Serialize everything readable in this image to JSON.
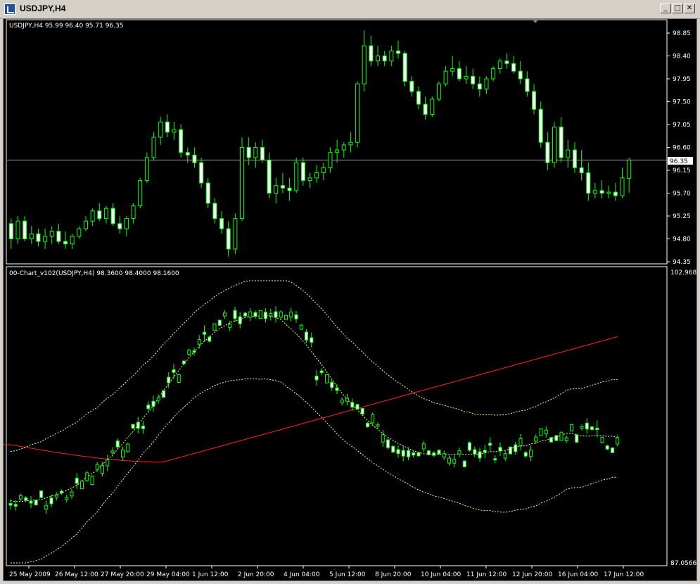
{
  "window": {
    "title": "USDJPY,H4",
    "controls": [
      "_",
      "□",
      "✕"
    ]
  },
  "main_panel": {
    "header": "USDJPY,H4  95.99 96.40 95.71 96.35",
    "current_price": "96.35",
    "yaxis_labels": [
      "98.85",
      "98.40",
      "97.95",
      "97.50",
      "97.05",
      "96.60",
      "96.15",
      "95.70",
      "95.25",
      "94.80",
      "94.35"
    ]
  },
  "indicator_panel": {
    "header": "00-Chart_v102(USDJPY,H4) 98.3600 98.4000 98.1600",
    "ymax_label": "102.9684",
    "ymin_label": "87.0566"
  },
  "xaxis_labels": [
    "25 May 2009",
    "26 May 12:00",
    "27 May 20:00",
    "29 May 04:00",
    "1 Jun 12:00",
    "2 Jun 20:00",
    "4 Jun 04:00",
    "5 Jun 12:00",
    "8 Jun 20:00",
    "10 Jun 04:00",
    "11 Jun 12:00",
    "12 Jun 20:00",
    "16 Jun 04:00",
    "17 Jun 12:00"
  ],
  "colors": {
    "background": "#000000",
    "candle": "#00ff00",
    "bull_body": "#000000",
    "bear_body": "#ffffff",
    "band": "#ffff66",
    "ma": "#ff2020",
    "price_line": "#a0a0a0",
    "axis": "#ffffff"
  },
  "chart_data": {
    "type": "candlestick",
    "symbol": "USDJPY",
    "timeframe": "H4",
    "ylim": [
      94.35,
      98.85
    ],
    "last_close": 96.35,
    "candles": [
      [
        95.1,
        95.2,
        94.6,
        94.8
      ],
      [
        94.8,
        95.25,
        94.7,
        95.15
      ],
      [
        95.15,
        95.25,
        94.75,
        94.8
      ],
      [
        94.8,
        95.05,
        94.7,
        94.9
      ],
      [
        94.9,
        95.0,
        94.65,
        94.75
      ],
      [
        94.75,
        95.0,
        94.6,
        94.85
      ],
      [
        94.85,
        95.05,
        94.7,
        94.95
      ],
      [
        94.95,
        95.1,
        94.7,
        94.75
      ],
      [
        94.75,
        94.95,
        94.6,
        94.7
      ],
      [
        94.7,
        94.9,
        94.6,
        94.85
      ],
      [
        94.85,
        95.05,
        94.8,
        95.0
      ],
      [
        95.0,
        95.25,
        94.95,
        95.15
      ],
      [
        95.15,
        95.4,
        95.05,
        95.35
      ],
      [
        95.35,
        95.5,
        95.15,
        95.2
      ],
      [
        95.2,
        95.45,
        95.1,
        95.4
      ],
      [
        95.4,
        95.5,
        95.05,
        95.1
      ],
      [
        95.1,
        95.25,
        94.9,
        95.0
      ],
      [
        95.0,
        95.25,
        94.85,
        95.2
      ],
      [
        95.2,
        95.5,
        95.1,
        95.45
      ],
      [
        95.45,
        96.0,
        95.4,
        95.95
      ],
      [
        95.95,
        96.5,
        95.9,
        96.4
      ],
      [
        96.4,
        96.9,
        96.35,
        96.8
      ],
      [
        96.8,
        97.2,
        96.65,
        97.1
      ],
      [
        97.1,
        97.25,
        96.8,
        96.9
      ],
      [
        96.9,
        97.1,
        96.75,
        96.95
      ],
      [
        96.95,
        97.05,
        96.4,
        96.5
      ],
      [
        96.5,
        96.6,
        96.3,
        96.45
      ],
      [
        96.45,
        96.6,
        96.2,
        96.3
      ],
      [
        96.3,
        96.4,
        95.8,
        95.9
      ],
      [
        95.9,
        96.0,
        95.4,
        95.5
      ],
      [
        95.5,
        95.6,
        95.1,
        95.2
      ],
      [
        95.2,
        95.35,
        94.9,
        95.0
      ],
      [
        95.0,
        95.15,
        94.45,
        94.6
      ],
      [
        94.6,
        95.3,
        94.5,
        95.2
      ],
      [
        95.2,
        96.8,
        95.15,
        96.6
      ],
      [
        96.6,
        96.8,
        96.25,
        96.4
      ],
      [
        96.4,
        96.7,
        96.2,
        96.6
      ],
      [
        96.6,
        96.75,
        96.3,
        96.35
      ],
      [
        96.35,
        96.5,
        95.6,
        95.7
      ],
      [
        95.7,
        96.0,
        95.5,
        95.85
      ],
      [
        95.85,
        96.1,
        95.7,
        95.8
      ],
      [
        95.8,
        96.0,
        95.55,
        95.75
      ],
      [
        95.75,
        96.4,
        95.7,
        96.3
      ],
      [
        96.3,
        96.4,
        95.85,
        95.95
      ],
      [
        95.95,
        96.1,
        95.8,
        96.0
      ],
      [
        96.0,
        96.25,
        95.9,
        96.1
      ],
      [
        96.1,
        96.3,
        95.95,
        96.2
      ],
      [
        96.2,
        96.6,
        96.1,
        96.5
      ],
      [
        96.5,
        96.75,
        96.3,
        96.55
      ],
      [
        96.55,
        96.7,
        96.4,
        96.65
      ],
      [
        96.65,
        96.9,
        96.5,
        96.7
      ],
      [
        96.7,
        97.9,
        96.6,
        97.85
      ],
      [
        97.85,
        98.9,
        97.7,
        98.6
      ],
      [
        98.6,
        98.8,
        98.2,
        98.3
      ],
      [
        98.3,
        98.6,
        98.2,
        98.4
      ],
      [
        98.4,
        98.5,
        98.2,
        98.3
      ],
      [
        98.3,
        98.6,
        98.2,
        98.5
      ],
      [
        98.5,
        98.7,
        98.35,
        98.45
      ],
      [
        98.45,
        98.5,
        97.8,
        97.9
      ],
      [
        97.9,
        98.0,
        97.6,
        97.7
      ],
      [
        97.7,
        97.8,
        97.35,
        97.45
      ],
      [
        97.45,
        97.6,
        97.15,
        97.25
      ],
      [
        97.25,
        97.6,
        97.2,
        97.55
      ],
      [
        97.55,
        97.9,
        97.5,
        97.85
      ],
      [
        97.85,
        98.2,
        97.8,
        98.1
      ],
      [
        98.1,
        98.4,
        98.0,
        98.15
      ],
      [
        98.15,
        98.3,
        97.9,
        97.95
      ],
      [
        97.95,
        98.2,
        97.85,
        98.0
      ],
      [
        98.0,
        98.15,
        97.75,
        97.85
      ],
      [
        97.85,
        98.0,
        97.6,
        97.75
      ],
      [
        97.75,
        98.0,
        97.65,
        97.95
      ],
      [
        97.95,
        98.2,
        97.9,
        98.15
      ],
      [
        98.15,
        98.35,
        98.05,
        98.3
      ],
      [
        98.3,
        98.45,
        98.15,
        98.25
      ],
      [
        98.25,
        98.4,
        98.05,
        98.1
      ],
      [
        98.1,
        98.3,
        97.85,
        97.95
      ],
      [
        97.95,
        98.1,
        97.6,
        97.7
      ],
      [
        97.7,
        97.85,
        97.25,
        97.35
      ],
      [
        97.35,
        97.5,
        96.6,
        96.7
      ],
      [
        96.7,
        96.9,
        96.15,
        96.3
      ],
      [
        96.3,
        97.1,
        96.2,
        97.0
      ],
      [
        97.0,
        97.2,
        96.3,
        96.4
      ],
      [
        96.4,
        96.75,
        96.2,
        96.55
      ],
      [
        96.55,
        96.7,
        96.1,
        96.2
      ],
      [
        96.2,
        96.55,
        95.95,
        96.1
      ],
      [
        96.1,
        96.3,
        95.55,
        95.7
      ],
      [
        95.7,
        95.9,
        95.6,
        95.75
      ],
      [
        95.75,
        95.95,
        95.6,
        95.7
      ],
      [
        95.7,
        95.85,
        95.6,
        95.72
      ],
      [
        95.72,
        95.9,
        95.55,
        95.65
      ],
      [
        95.65,
        96.2,
        95.6,
        96.0
      ],
      [
        95.99,
        96.4,
        95.71,
        96.35
      ]
    ],
    "indicator": {
      "name": "00-Chart_v102(USDJPY,H4)",
      "values": [
        98.36,
        98.4,
        98.16
      ],
      "ylim": [
        87.0566,
        102.9684
      ]
    }
  }
}
